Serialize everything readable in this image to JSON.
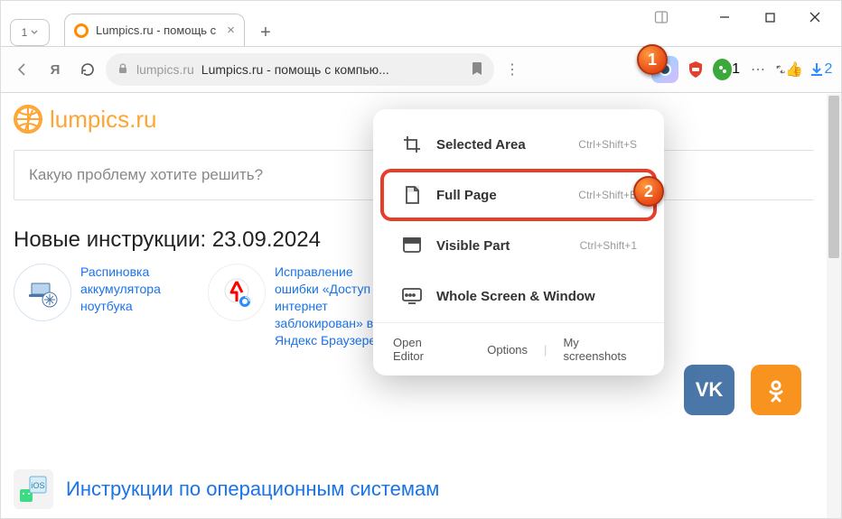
{
  "window": {
    "tab_count": "1",
    "tab_title": "Lumpics.ru - помощь с",
    "addr_host": "lumpics.ru",
    "addr_title": "Lumpics.ru - помощь с компью...",
    "ext_green_badge": "1",
    "ext_dl_badge": "2"
  },
  "site": {
    "name": "lumpics.ru",
    "search_placeholder": "Какую проблему хотите решить?",
    "section_title": "Новые инструкции: 23.09.2024",
    "article1": "Распиновка аккумулятора ноутбука",
    "article2": "Исправление ошибки «Доступ в интернет заблокирован» в Яндекс Браузере",
    "category_title": "Инструкции по операционным системам",
    "vk_label": "VK",
    "ok_symbol": "✶"
  },
  "dropdown": {
    "items": [
      {
        "label": "Selected Area",
        "shortcut": "Ctrl+Shift+S"
      },
      {
        "label": "Full Page",
        "shortcut": "Ctrl+Shift+E"
      },
      {
        "label": "Visible Part",
        "shortcut": "Ctrl+Shift+1"
      },
      {
        "label": "Whole Screen & Window",
        "shortcut": ""
      }
    ],
    "footer": {
      "open_editor": "Open Editor",
      "options": "Options",
      "my_screenshots": "My screenshots"
    }
  },
  "annotations": {
    "step1": "1",
    "step2": "2"
  }
}
